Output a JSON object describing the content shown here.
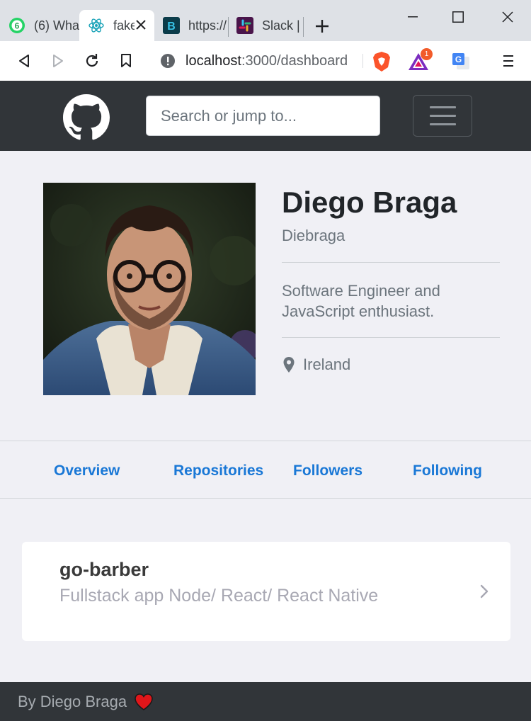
{
  "browser": {
    "tabs": [
      {
        "title": "(6) Wha",
        "icon": "whatsapp-icon",
        "badge": "6"
      },
      {
        "title": "fake",
        "icon": "react-icon",
        "active": true
      },
      {
        "title": "https://",
        "icon": "bootstrap-icon"
      },
      {
        "title": "Slack |",
        "icon": "slack-icon"
      }
    ],
    "url_host": "localhost",
    "url_path": ":3000/dashboard",
    "brave_badge": "1"
  },
  "header": {
    "search_placeholder": "Search or jump to..."
  },
  "profile": {
    "name": "Diego Braga",
    "login": "Diebraga",
    "bio": "Software Engineer and JavaScript enthusiast.",
    "location": "Ireland"
  },
  "nav": {
    "overview": "Overview",
    "repositories": "Repositories",
    "followers": "Followers",
    "following": "Following"
  },
  "repos": [
    {
      "name": "go-barber",
      "description": "Fullstack app Node/ React/ React Native"
    }
  ],
  "footer": {
    "text": "By Diego Braga"
  },
  "colors": {
    "header_bg": "#313539",
    "link_blue": "#1a78d6",
    "page_bg": "#f0f0f5",
    "heart_red": "#e0161a"
  }
}
